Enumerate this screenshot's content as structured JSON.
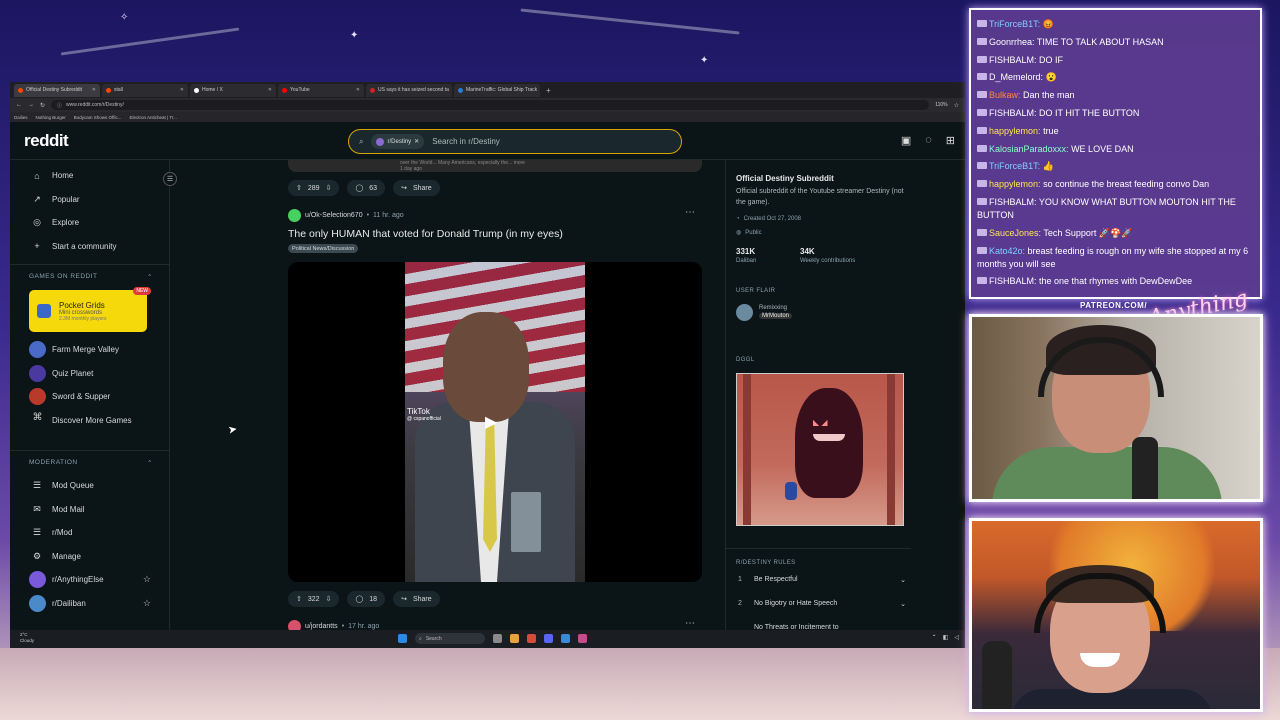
{
  "browser": {
    "tabs": [
      {
        "label": "Official Destiny Subreddit",
        "color": "#ff4500",
        "active": true
      },
      {
        "label": "stall",
        "color": "#ff4500"
      },
      {
        "label": "Home / X",
        "color": "#ffffff"
      },
      {
        "label": "YouTube",
        "color": "#ff0000"
      },
      {
        "label": "US says it has seized second ta",
        "color": "#cc2222"
      },
      {
        "label": "MarineTraffic: Global Ship Track",
        "color": "#2a7ad8"
      }
    ],
    "url": "www.reddit.com/r/Destiny/",
    "zoom": "110%",
    "bookmarks": [
      "Dailies",
      "Nothing Burger",
      "Bodycam Shows Offic...",
      "Electron Anticheat | Tr..."
    ]
  },
  "reddit": {
    "logo": "reddit",
    "search": {
      "chip": "r/Destiny",
      "placeholder": "Search in r/Destiny"
    },
    "nav": [
      {
        "label": "Home",
        "icon": "home-icon",
        "glyph": "⌂"
      },
      {
        "label": "Popular",
        "icon": "popular-icon",
        "glyph": "↗"
      },
      {
        "label": "Explore",
        "icon": "explore-icon",
        "glyph": "◎"
      },
      {
        "label": "Start a community",
        "icon": "plus-icon",
        "glyph": "+"
      }
    ],
    "games_header": "GAMES ON REDDIT",
    "pocket": {
      "title": "Pocket Grids",
      "subtitle": "Mini crosswords",
      "players": "2.3M monthly players",
      "badge": "NEW"
    },
    "games": [
      {
        "label": "Farm Merge Valley",
        "color": "#4a6ac8"
      },
      {
        "label": "Quiz Planet",
        "color": "#4a3aa0"
      },
      {
        "label": "Sword & Supper",
        "color": "#b83a2a"
      }
    ],
    "discover": "Discover More Games",
    "moderation_header": "MODERATION",
    "mod_items": [
      {
        "label": "Mod Queue",
        "glyph": "☰"
      },
      {
        "label": "Mod Mail",
        "glyph": "✉"
      },
      {
        "label": "r/Mod",
        "glyph": "☰"
      },
      {
        "label": "Manage",
        "glyph": "⚙"
      }
    ],
    "communities": [
      {
        "label": "r/AnythingElse",
        "color": "#7a5ad8"
      },
      {
        "label": "r/Dailiban",
        "color": "#4a8ac8"
      }
    ],
    "prev_post": {
      "text": "over the World... Many Americans, especially the...  more",
      "time": "1 day ago",
      "votes": "289",
      "comments": "63",
      "share": "Share"
    },
    "post": {
      "author": "u/Ok-Selection670",
      "time": "11 hr. ago",
      "title": "The only HUMAN that voted for Donald Trump (in my eyes)",
      "flair": "Political News/Discussion",
      "video_tag": "TikTok",
      "video_handle": "@ cspanofficial",
      "votes": "322",
      "comments": "18",
      "share": "Share"
    },
    "next_post": {
      "author": "u/jordantts",
      "time": "17 hr. ago"
    },
    "sidebar_right": {
      "title": "Official Destiny Subreddit",
      "desc": "Official subreddit of the Youtube streamer Destiny (not the game).",
      "created": "Created Oct 27, 2008",
      "visibility": "Public",
      "members": "331K",
      "members_label": "Daliban",
      "contrib": "34K",
      "contrib_label": "Weekly contributions",
      "user_flair_header": "USER FLAIR",
      "user_flair_name": "Remixxing",
      "user_flair_tag": "MrMouton",
      "dggl_header": "DGGL",
      "rules_header": "R/DESTINY RULES",
      "rules": [
        {
          "n": "1",
          "label": "Be Respectful"
        },
        {
          "n": "2",
          "label": "No Bigotry or Hate Speech"
        },
        {
          "n": "",
          "label": "No Threats or Incitement to"
        }
      ]
    }
  },
  "taskbar": {
    "weather_temp": "2°C",
    "weather_desc": "Cloudy",
    "search": "Search"
  },
  "chat": [
    {
      "user": "TriForceB1T:",
      "color": "#7fd0ff",
      "text": "😡"
    },
    {
      "user": "Goonrrhea:",
      "color": "#ffffff",
      "text": "TIME TO TALK ABOUT HASAN"
    },
    {
      "user": "FISHBALM:",
      "color": "#ffffff",
      "text": "DO IF"
    },
    {
      "user": "D_Memelord:",
      "color": "#ffffff",
      "text": "😮"
    },
    {
      "user": "Bulkaw:",
      "color": "#ff8a3a",
      "text": "Dan the man"
    },
    {
      "user": "FISHBALM:",
      "color": "#ffffff",
      "text": "DO IT HIT THE BUTTON"
    },
    {
      "user": "happylemon:",
      "color": "#ffe84a",
      "text": "true"
    },
    {
      "user": "KalosianParadoxxx:",
      "color": "#8affc8",
      "text": "WE LOVE DAN"
    },
    {
      "user": "TriForceB1T:",
      "color": "#7fd0ff",
      "text": "👍"
    },
    {
      "user": "happylemon:",
      "color": "#ffe84a",
      "text": "so continue the breast feeding convo Dan"
    },
    {
      "user": "FISHBALM:",
      "color": "#ffffff",
      "text": "YOU KNOW WHAT BUTTON MOUTON HIT THE BUTTON"
    },
    {
      "user": "SauceJones:",
      "color": "#ffe84a",
      "text": "Tech Support 🚀🍄🚀"
    },
    {
      "user": "Kato42o:",
      "color": "#7fd0ff",
      "text": "breast feeding is rough on my wife she stopped at my 6 months you will see"
    },
    {
      "user": "FISHBALM:",
      "color": "#ffffff",
      "text": "the one that rhymes with DewDewDee"
    }
  ],
  "overlay": {
    "patreon": "PATREON.COM/",
    "brand": "Anything Else"
  }
}
